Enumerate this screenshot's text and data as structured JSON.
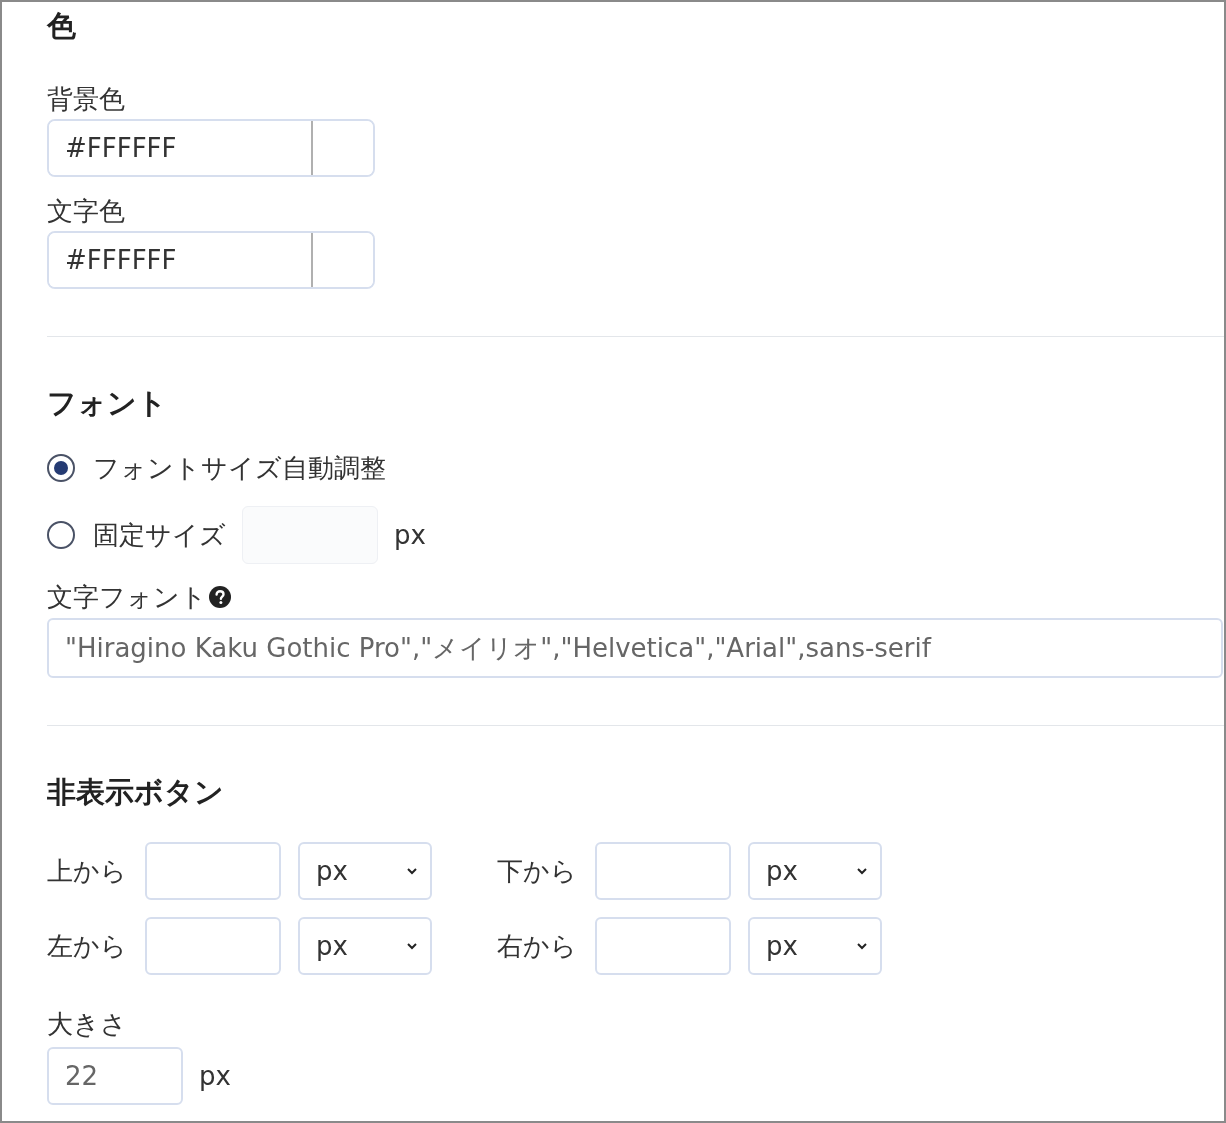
{
  "color_section": {
    "title": "色",
    "fields": [
      {
        "label": "背景色",
        "value": "#FFFFFF"
      },
      {
        "label": "文字色",
        "value": "#FFFFFF"
      }
    ]
  },
  "font_section": {
    "title": "フォント",
    "size_options": [
      {
        "kind": "auto",
        "label": "フォントサイズ自動調整",
        "selected": true
      },
      {
        "kind": "fixed",
        "label": "固定サイズ",
        "selected": false,
        "disabled": true,
        "unit": "px"
      }
    ],
    "font_family": {
      "label": "文字フォント",
      "placeholder": "\"Hiragino Kaku Gothic Pro\",\"メイリオ\",\"Helvetica\",\"Arial\",sans-serif"
    }
  },
  "hide_button_section": {
    "title": "非表示ボタン",
    "positions": [
      {
        "label": "上から",
        "unit": "px"
      },
      {
        "label": "下から",
        "unit": "px"
      },
      {
        "label": "左から",
        "unit": "px"
      },
      {
        "label": "右から",
        "unit": "px"
      }
    ],
    "size": {
      "label": "大きさ",
      "placeholder": "22",
      "unit": "px"
    }
  }
}
